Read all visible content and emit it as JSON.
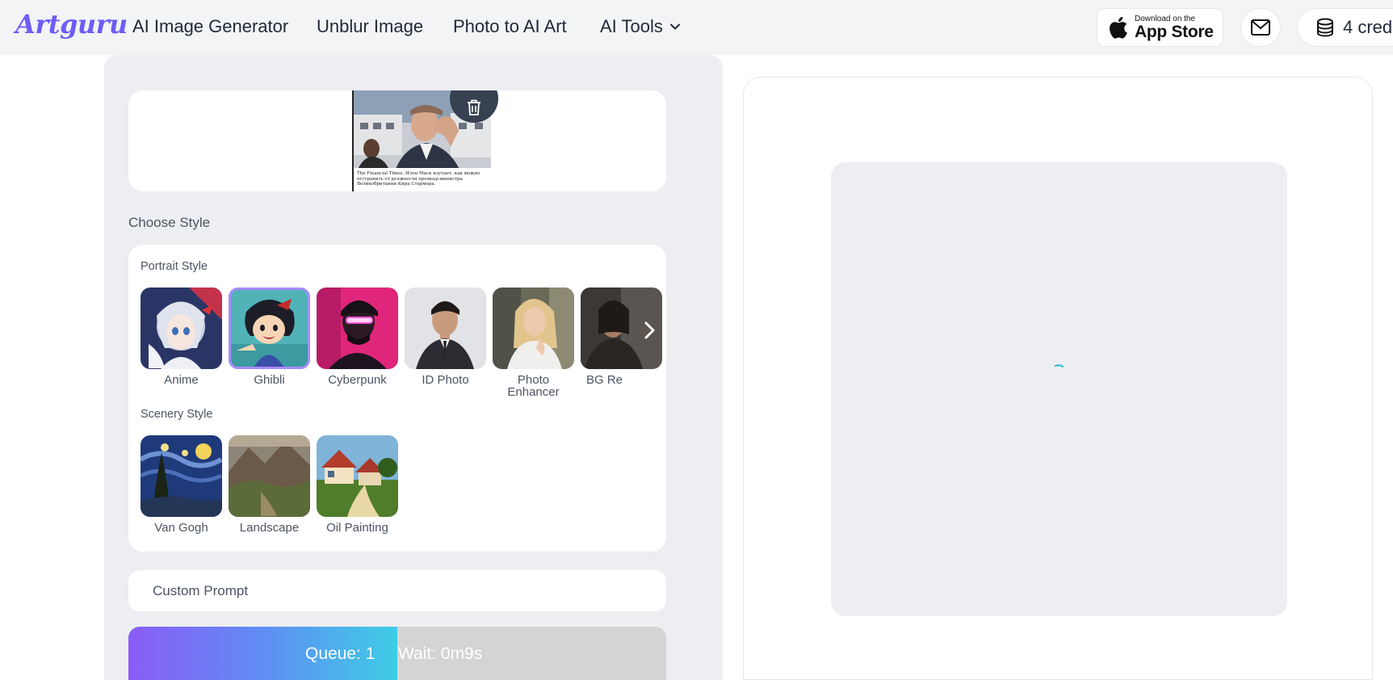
{
  "header": {
    "logo": "Artguru",
    "nav": [
      {
        "label": "AI Image Generator"
      },
      {
        "label": "Unblur Image"
      },
      {
        "label": "Photo to AI Art"
      },
      {
        "label": "AI Tools"
      }
    ],
    "app_store": {
      "small": "Download on the",
      "big": "App Store"
    },
    "credits": "4 cred"
  },
  "upload": {
    "caption": "The Financial Times. Илон Маск изучает, как можно отстранить от должности премьер-министра Великобритании Кира Стармера."
  },
  "styles": {
    "title": "Choose Style",
    "portrait_label": "Portrait Style",
    "portrait": [
      {
        "label": "Anime",
        "selected": false
      },
      {
        "label": "Ghibli",
        "selected": true
      },
      {
        "label": "Cyberpunk",
        "selected": false
      },
      {
        "label": "ID Photo",
        "selected": false
      },
      {
        "label": "Photo Enhancer",
        "selected": false
      },
      {
        "label": "BG Re",
        "selected": false
      }
    ],
    "scenery_label": "Scenery Style",
    "scenery": [
      {
        "label": "Van Gogh"
      },
      {
        "label": "Landscape"
      },
      {
        "label": "Oil Painting"
      }
    ]
  },
  "prompt": {
    "label": "Custom Prompt"
  },
  "queue": {
    "queue_text": "Queue: 1",
    "wait_text": "Wait: 0m9s",
    "progress": 0.5
  },
  "colors": {
    "accent": "#8b5cf6",
    "selected_outline": "#a78bfa",
    "panel_bg": "#eceef1",
    "spinner": "#22b8d8"
  },
  "icons": [
    "chevron-down-icon",
    "apple-icon",
    "mail-icon",
    "coins-icon",
    "trash-icon",
    "chevron-right-icon",
    "loading-spinner-icon"
  ]
}
